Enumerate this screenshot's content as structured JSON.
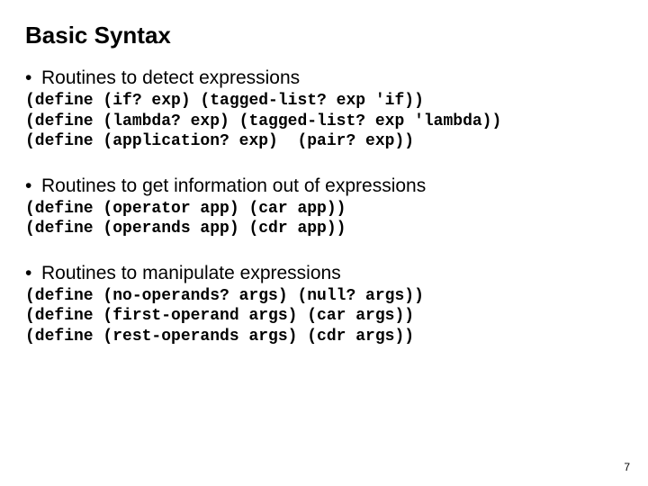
{
  "title": "Basic Syntax",
  "sections": [
    {
      "heading": "Routines to detect expressions",
      "code": "(define (if? exp) (tagged-list? exp 'if))\n(define (lambda? exp) (tagged-list? exp 'lambda))\n(define (application? exp)  (pair? exp))"
    },
    {
      "heading": "Routines to get information out of expressions",
      "code": "(define (operator app) (car app))\n(define (operands app) (cdr app))"
    },
    {
      "heading": "Routines to manipulate expressions",
      "code": "(define (no-operands? args) (null? args))\n(define (first-operand args) (car args))\n(define (rest-operands args) (cdr args))"
    }
  ],
  "page_number": "7"
}
